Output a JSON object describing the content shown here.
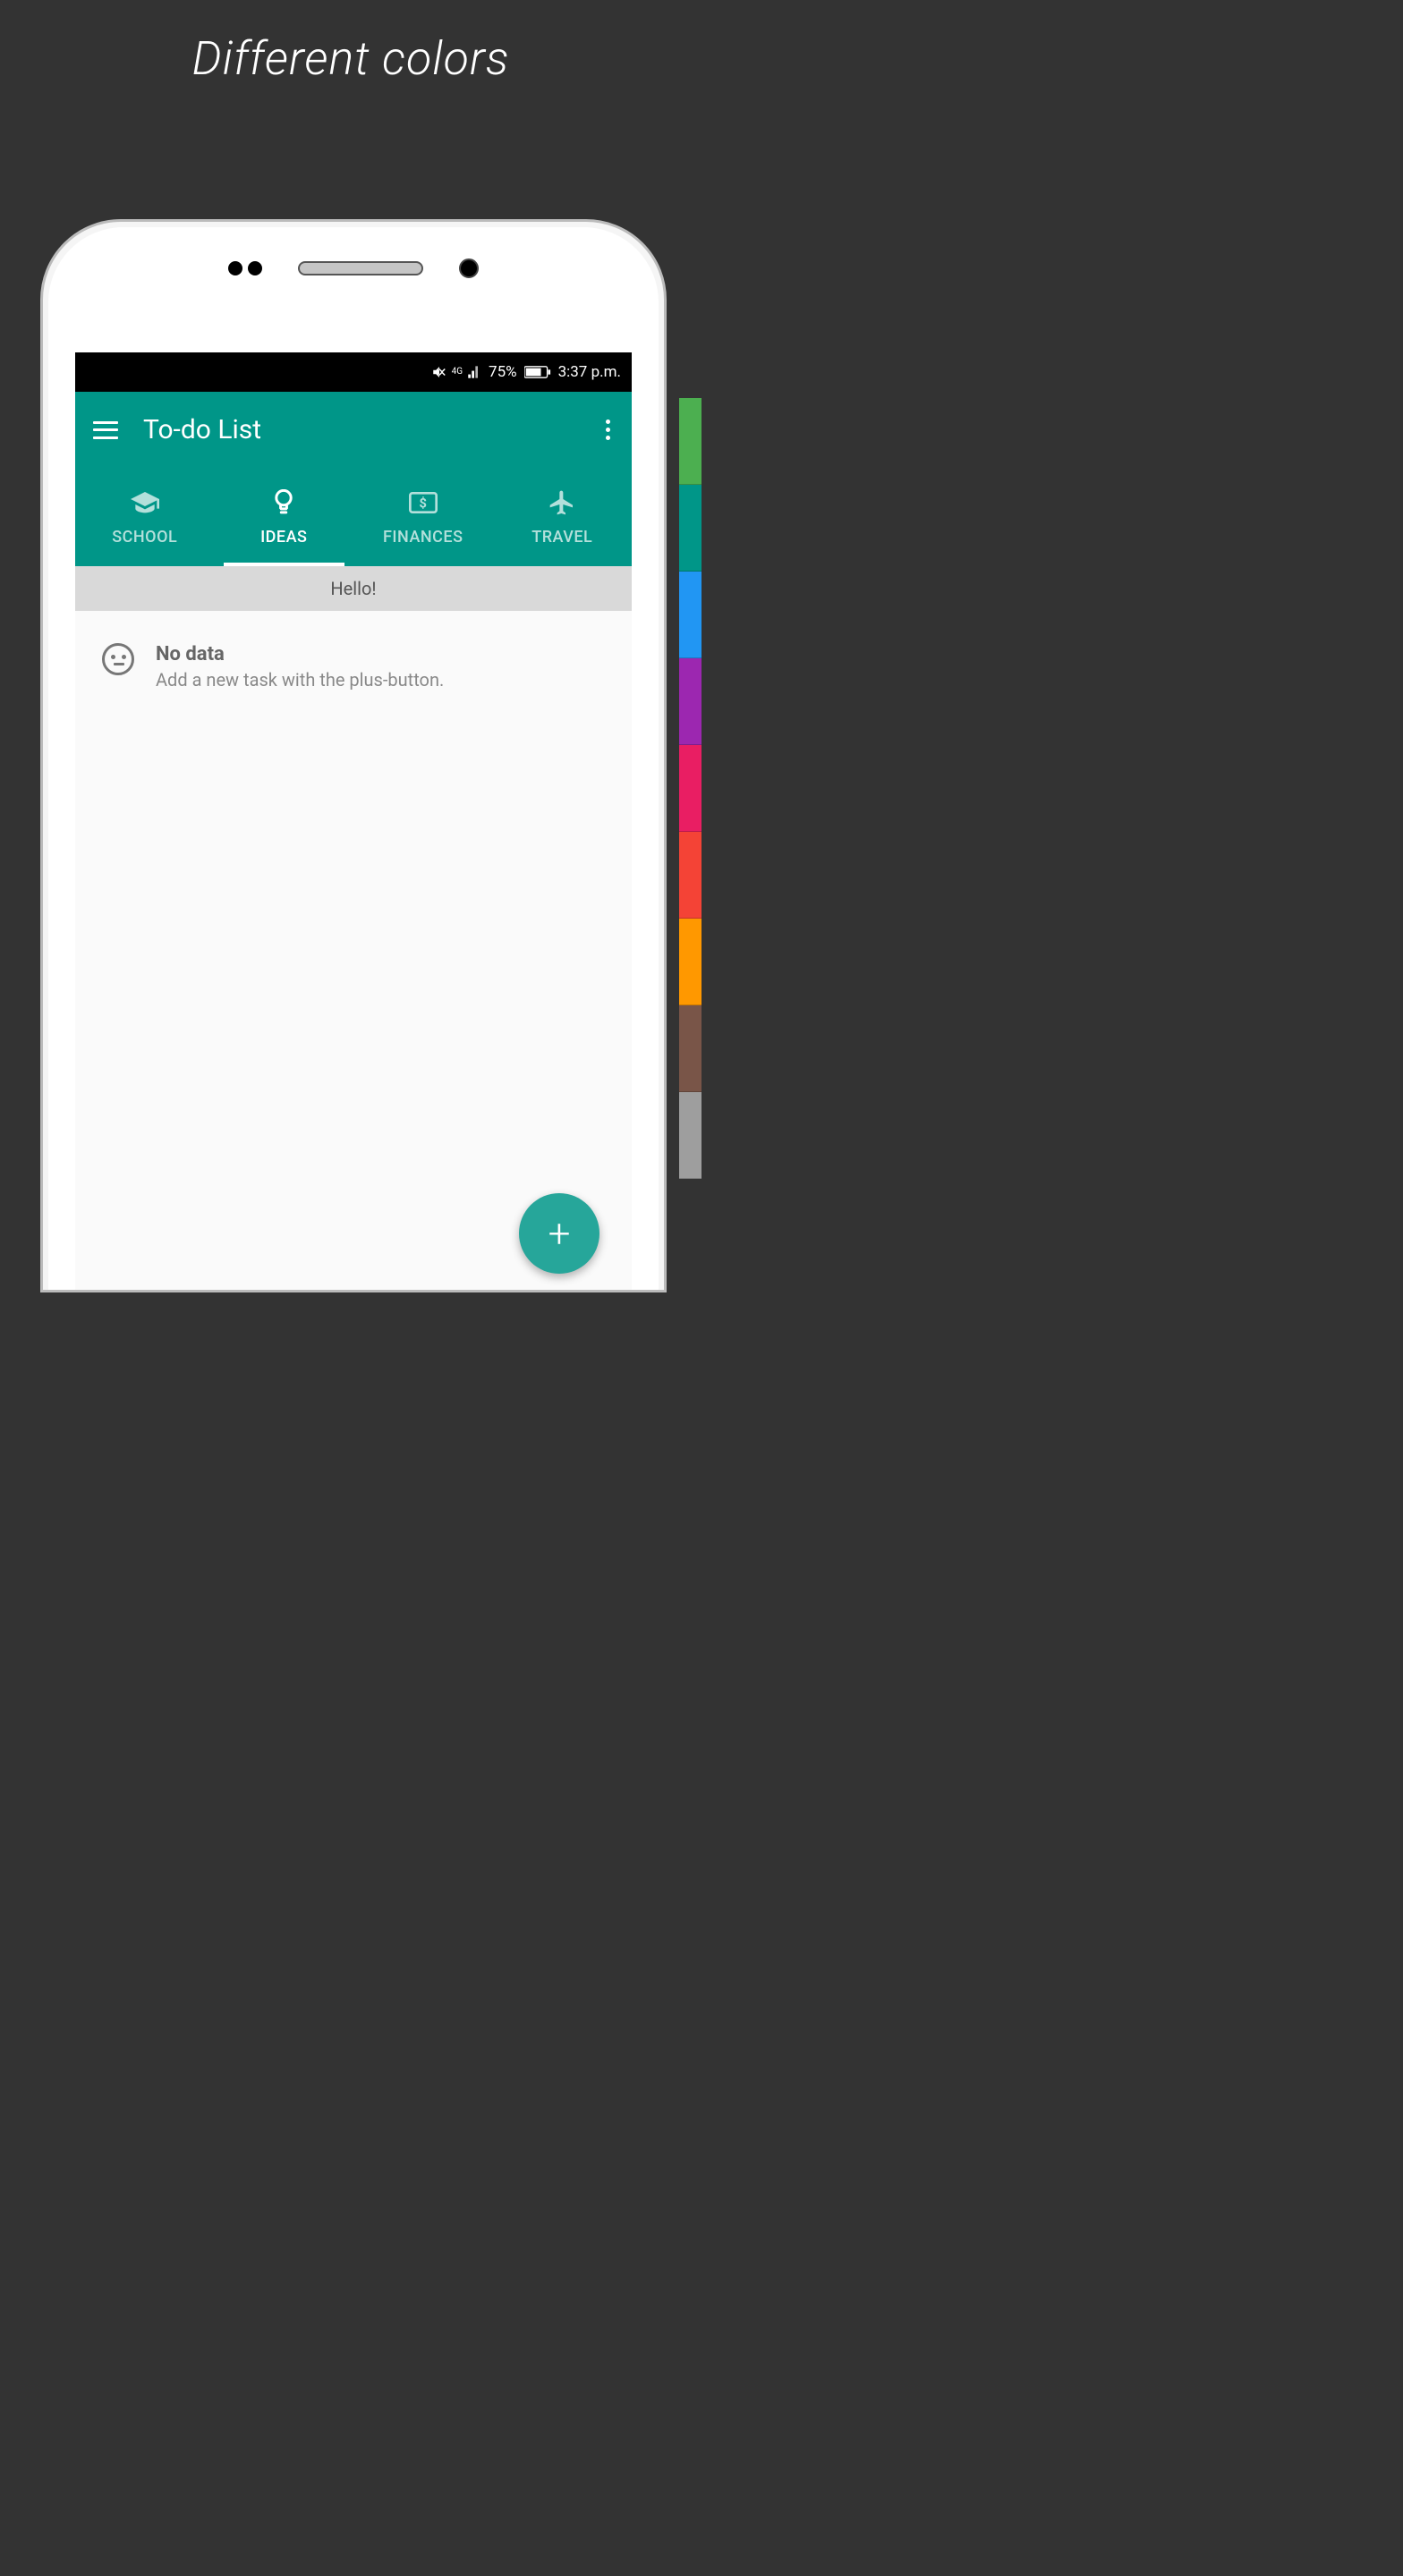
{
  "promo": {
    "title": "Different colors"
  },
  "color_swatches": [
    "#4caf50",
    "#009688",
    "#2196f3",
    "#9c27b0",
    "#e91e63",
    "#f44336",
    "#ff9800",
    "#795548",
    "#9e9e9e"
  ],
  "status_bar": {
    "battery_percent": "75%",
    "time": "3:37 p.m.",
    "network_label": "4G"
  },
  "app_bar": {
    "title": "To-do List"
  },
  "tabs": [
    {
      "label": "SCHOOL",
      "icon": "school-icon"
    },
    {
      "label": "IDEAS",
      "icon": "lightbulb-icon"
    },
    {
      "label": "FINANCES",
      "icon": "money-icon"
    },
    {
      "label": "TRAVEL",
      "icon": "airplane-icon"
    }
  ],
  "active_tab_index": 1,
  "banner": {
    "text": "Hello!"
  },
  "empty_state": {
    "title": "No data",
    "subtitle": "Add a new task with the plus-button."
  },
  "fab": {
    "label": "+"
  }
}
